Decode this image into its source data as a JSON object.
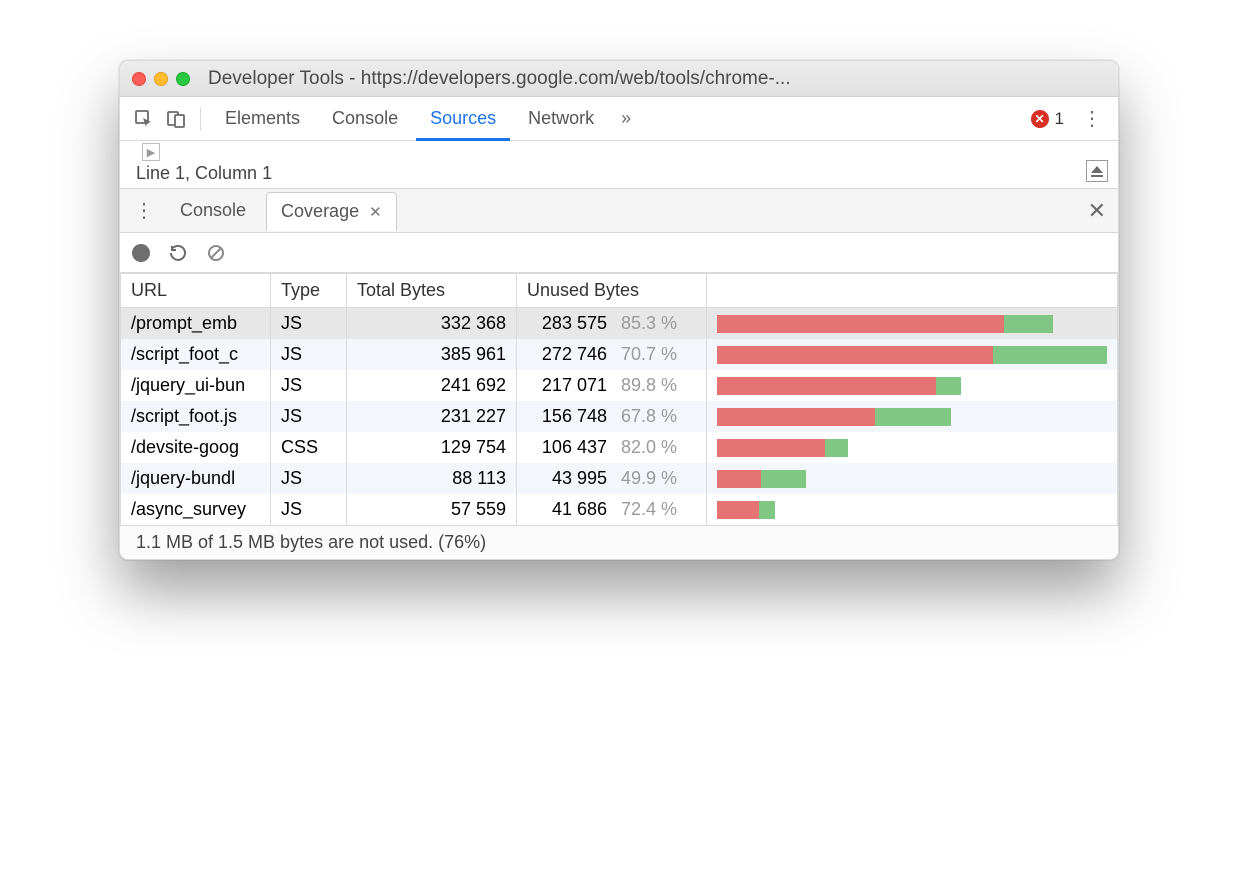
{
  "window": {
    "title": "Developer Tools - https://developers.google.com/web/tools/chrome-..."
  },
  "tabs": {
    "items": [
      "Elements",
      "Console",
      "Sources",
      "Network"
    ],
    "active": "Sources",
    "error_count": "1"
  },
  "source": {
    "cursor": "Line 1, Column 1"
  },
  "drawer": {
    "tabs": {
      "console": "Console",
      "coverage": "Coverage"
    }
  },
  "coverage": {
    "headers": {
      "url": "URL",
      "type": "Type",
      "total": "Total Bytes",
      "unused": "Unused Bytes"
    },
    "max_bytes": 385961,
    "rows": [
      {
        "url": "/prompt_emb",
        "type": "JS",
        "total": "332 368",
        "unused": "283 575",
        "pct": "85.3 %",
        "total_n": 332368,
        "unused_n": 283575,
        "selected": true
      },
      {
        "url": "/script_foot_c",
        "type": "JS",
        "total": "385 961",
        "unused": "272 746",
        "pct": "70.7 %",
        "total_n": 385961,
        "unused_n": 272746
      },
      {
        "url": "/jquery_ui-bun",
        "type": "JS",
        "total": "241 692",
        "unused": "217 071",
        "pct": "89.8 %",
        "total_n": 241692,
        "unused_n": 217071
      },
      {
        "url": "/script_foot.js",
        "type": "JS",
        "total": "231 227",
        "unused": "156 748",
        "pct": "67.8 %",
        "total_n": 231227,
        "unused_n": 156748
      },
      {
        "url": "/devsite-goog",
        "type": "CSS",
        "total": "129 754",
        "unused": "106 437",
        "pct": "82.0 %",
        "total_n": 129754,
        "unused_n": 106437
      },
      {
        "url": "/jquery-bundl",
        "type": "JS",
        "total": "88 113",
        "unused": "43 995",
        "pct": "49.9 %",
        "total_n": 88113,
        "unused_n": 43995
      },
      {
        "url": "/async_survey",
        "type": "JS",
        "total": "57 559",
        "unused": "41 686",
        "pct": "72.4 %",
        "total_n": 57559,
        "unused_n": 41686
      }
    ],
    "status": "1.1 MB of 1.5 MB bytes are not used. (76%)"
  }
}
